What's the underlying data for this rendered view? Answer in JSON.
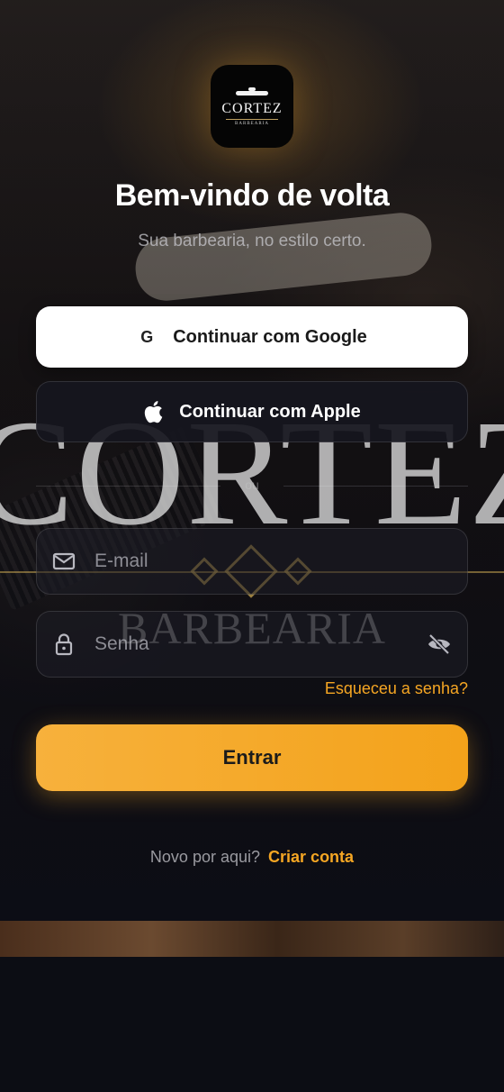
{
  "brand": {
    "logo_name": "CORTEZ",
    "logo_subtitle": "BARBEARIA",
    "watermark_name": "CORTEZ",
    "watermark_subtitle": "BARBEARIA"
  },
  "header": {
    "title": "Bem-vindo de volta",
    "subtitle": "Sua barbearia, no estilo certo."
  },
  "social_login": {
    "google_label": "Continuar com Google",
    "google_icon_glyph": "G",
    "apple_label": "Continuar com Apple"
  },
  "divider_label": "ou",
  "form": {
    "email": {
      "value": "",
      "placeholder": "E-mail"
    },
    "password": {
      "value": "",
      "placeholder": "Senha"
    },
    "forgot_label": "Esqueceu a senha?",
    "submit_label": "Entrar"
  },
  "footer": {
    "question": "Novo por aqui?",
    "signup_label": "Criar conta"
  },
  "colors": {
    "accent": "#f5a623",
    "background": "#0c0d14",
    "button_light": "#ffffff",
    "button_dark": "#16161e"
  }
}
